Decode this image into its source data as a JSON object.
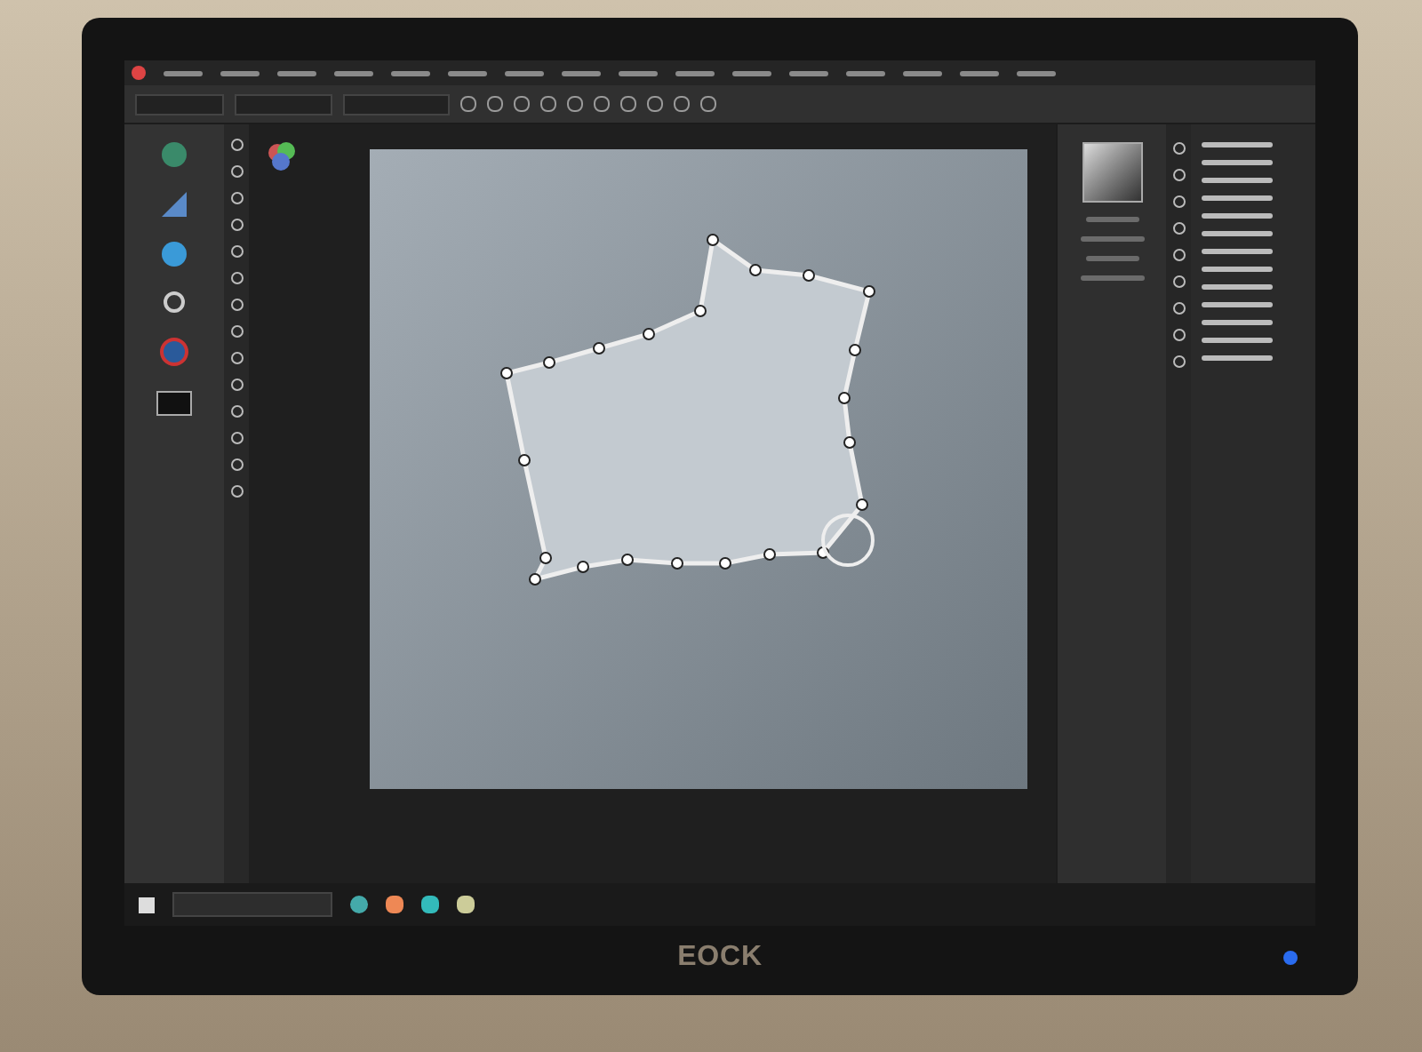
{
  "monitor": {
    "brand": "EOCK",
    "power_on": true
  }
}
